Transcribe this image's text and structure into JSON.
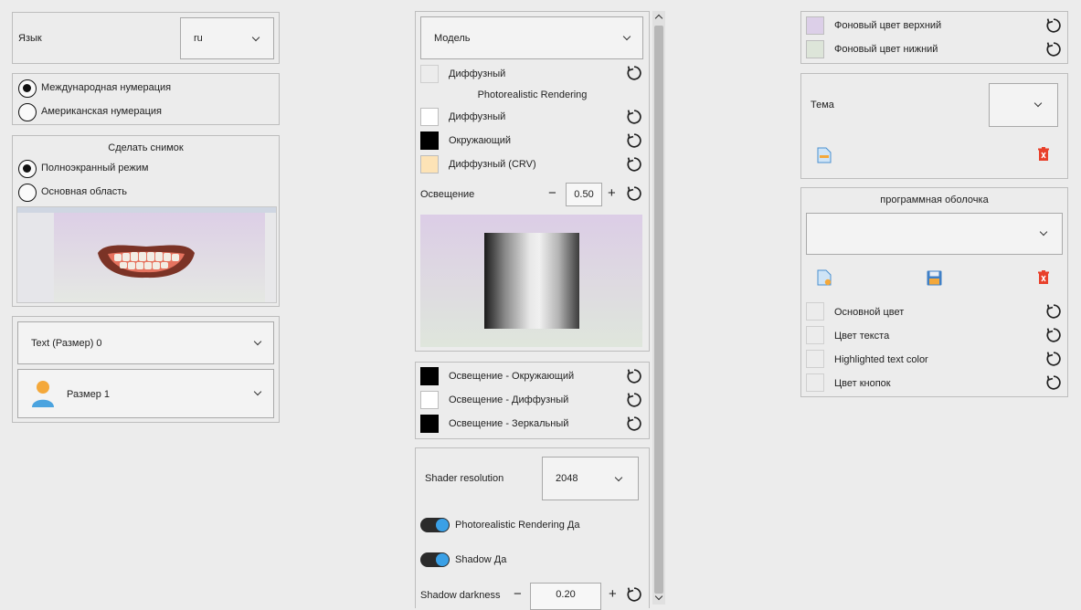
{
  "left": {
    "language_label": "Язык",
    "language_value": "ru",
    "numbering": {
      "options": [
        {
          "label": "Международная нумерация",
          "selected": true
        },
        {
          "label": "Американская нумерация",
          "selected": false
        }
      ]
    },
    "snapshot": {
      "title": "Сделать снимок",
      "options": [
        {
          "label": "Полноэкранный режим",
          "selected": true
        },
        {
          "label": "Основная область",
          "selected": false
        }
      ]
    },
    "text_size_value": "Text (Размер) 0",
    "size_value": "Размер 1"
  },
  "middle": {
    "model_value": "Модель",
    "diffuse_label": "Диффузный",
    "pr_title": "Photorealistic Rendering",
    "pr_colors": [
      {
        "label": "Диффузный",
        "color": "#ffffff"
      },
      {
        "label": "Окружающий",
        "color": "#000000"
      },
      {
        "label": "Диффузный (CRV)",
        "color": "#fde3b6"
      }
    ],
    "lighting_label": "Освещение",
    "lighting_value": "0.50",
    "light_colors": [
      {
        "label": "Освещение - Окружающий",
        "color": "#000000"
      },
      {
        "label": "Освещение - Диффузный",
        "color": "#ffffff"
      },
      {
        "label": "Освещение - Зеркальный",
        "color": "#000000"
      }
    ],
    "shader_label": "Shader resolution",
    "shader_value": "2048",
    "toggle_pr": "Photorealistic Rendering Да",
    "toggle_shadow": "Shadow Да",
    "shadow_label": "Shadow darkness",
    "shadow_value": "0.20",
    "minus": "−",
    "plus": "+"
  },
  "right": {
    "bg_colors": [
      {
        "label": "Фоновый цвет верхний",
        "color": "#dccfe8"
      },
      {
        "label": "Фоновый цвет нижний",
        "color": "#dde5d9"
      }
    ],
    "theme_label": "Тема",
    "shell_title": "программная оболочка",
    "shell_colors": [
      {
        "label": "Основной цвет"
      },
      {
        "label": "Цвет текста"
      },
      {
        "label": "Highlighted text color"
      },
      {
        "label": "Цвет кнопок"
      }
    ]
  },
  "colors": {
    "accent": "#3aa0e6",
    "delete": "#e8402a"
  }
}
